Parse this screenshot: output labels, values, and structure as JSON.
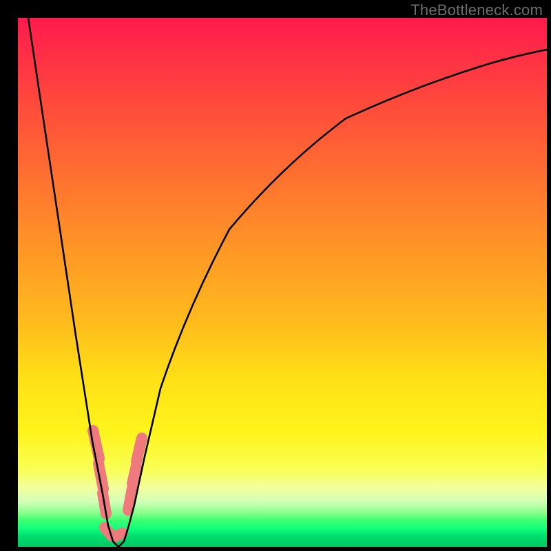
{
  "watermark": "TheBottleneck.com",
  "chart_data": {
    "type": "line",
    "title": "",
    "xlabel": "",
    "ylabel": "",
    "xlim": [
      0,
      100
    ],
    "ylim": [
      0,
      100
    ],
    "grid": false,
    "legend": false,
    "curve_color": "#000000",
    "background": "spectral-gradient-red-to-green",
    "series": [
      {
        "name": "bottleneck-curve",
        "x": [
          2,
          5,
          8,
          11,
          14,
          16,
          17,
          18,
          19,
          20,
          21,
          22,
          24,
          27,
          32,
          40,
          50,
          62,
          75,
          88,
          100
        ],
        "values": [
          100,
          80,
          60,
          40,
          20,
          10,
          4,
          1,
          0,
          1,
          4,
          8,
          17,
          30,
          45,
          60,
          72,
          81,
          87,
          91,
          94
        ]
      }
    ],
    "markers": {
      "name": "highlight-sausages",
      "color": "#ee7a7d",
      "clusters": [
        {
          "arm": "left",
          "x_start": 14.2,
          "x_end": 16.8,
          "y_start": 22,
          "y_end": 6
        },
        {
          "arm": "right",
          "x_start": 20.5,
          "x_end": 23.2,
          "y_start": 6,
          "y_end": 16
        },
        {
          "arm": "bottom",
          "x_start": 16.2,
          "x_end": 20.2,
          "y_start": 2,
          "y_end": 2
        }
      ]
    }
  }
}
